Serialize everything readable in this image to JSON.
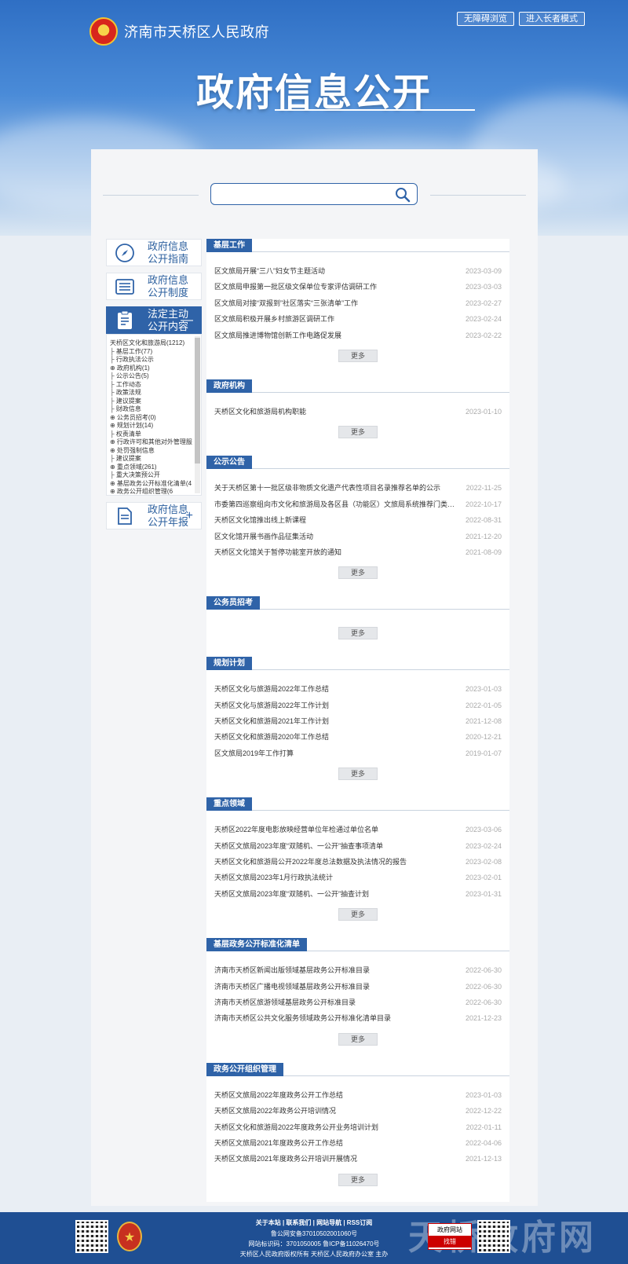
{
  "header": {
    "site_name": "济南市天桥区人民政府",
    "btn_accessible": "无障碍浏览",
    "btn_elder": "进入长者模式",
    "title": "政府信息公开"
  },
  "search": {
    "value": "",
    "placeholder": ""
  },
  "sidebar": {
    "cards": [
      {
        "label": "政府信息公开指南",
        "icon": "compass-icon"
      },
      {
        "label": "政府信息公开制度",
        "icon": "list-icon"
      },
      {
        "label": "法定主动公开内容",
        "icon": "clipboard-icon",
        "sign": "—"
      },
      {
        "label": "政府信息公开年报",
        "icon": "document-icon",
        "sign": "+"
      }
    ],
    "tree": [
      "天桥区文化和旅游局(1212)",
      "├ 基层工作(77)",
      "├ 行政执法公示",
      "⊕ 政府机构(1)",
      "├ 公示公告(5)",
      "├ 工作动态",
      "├ 政策法规",
      "├ 建议提案",
      "├ 财政信息",
      "⊕ 公务员招考(0)",
      "⊕ 规划计划(14)",
      "├ 权责清单",
      "⊕ 行政许可和其他对外管理服",
      "⊕ 处罚强制信息",
      "├ 建议提案",
      "⊕ 重点领域(261)",
      "├ 重大决策预公开",
      "⊕ 基层政务公开标准化清单(4",
      "⊕ 政务公开组织管理(6"
    ]
  },
  "sections": [
    {
      "title": "基层工作",
      "more": "更多",
      "items": [
        {
          "t": "区文旅局开展“三八”妇女节主题活动",
          "d": "2023-03-09"
        },
        {
          "t": "区文旅局申报第一批区级文保单位专家评估调研工作",
          "d": "2023-03-03"
        },
        {
          "t": "区文旅局对接“双报到”社区落实“三张清单”工作",
          "d": "2023-02-27"
        },
        {
          "t": "区文旅局积极开展乡村旅游区调研工作",
          "d": "2023-02-24"
        },
        {
          "t": "区文旅局推进博物馆创新工作电路促发展",
          "d": "2023-02-22"
        }
      ]
    },
    {
      "title": "政府机构",
      "more": "更多",
      "items": [
        {
          "t": "天桥区文化和旅游局机构职能",
          "d": "2023-01-10"
        }
      ]
    },
    {
      "title": "公示公告",
      "more": "更多",
      "items": [
        {
          "t": "关于天桥区第十一批区级非物质文化遗产代表性项目名录推荐名单的公示",
          "d": "2022-11-25"
        },
        {
          "t": "市委第四巡察组向市文化和旅游局及各区县（功能区）文旅局系统推荐门类组织...",
          "d": "2022-10-17"
        },
        {
          "t": "天桥区文化馆推出线上新课程",
          "d": "2022-08-31"
        },
        {
          "t": "区文化馆开展书画作品征集活动",
          "d": "2021-12-20"
        },
        {
          "t": "天桥区文化馆关于暂停功能室开放的通知",
          "d": "2021-08-09"
        }
      ]
    },
    {
      "title": "公务员招考",
      "more": "更多",
      "items": []
    },
    {
      "title": "规划计划",
      "more": "更多",
      "items": [
        {
          "t": "天桥区文化与旅游局2022年工作总结",
          "d": "2023-01-03"
        },
        {
          "t": "天桥区文化与旅游局2022年工作计划",
          "d": "2022-01-05"
        },
        {
          "t": "天桥区文化和旅游局2021年工作计划",
          "d": "2021-12-08"
        },
        {
          "t": "天桥区文化和旅游局2020年工作总结",
          "d": "2020-12-21"
        },
        {
          "t": "区文旅局2019年工作打算",
          "d": "2019-01-07"
        }
      ]
    },
    {
      "title": "重点领域",
      "more": "更多",
      "items": [
        {
          "t": "天桥区2022年度电影放映经营单位年检通过单位名单",
          "d": "2023-03-06"
        },
        {
          "t": "天桥区文旅局2023年度“双随机、一公开”抽查事项清单",
          "d": "2023-02-24"
        },
        {
          "t": "天桥区文化和旅游局公开2022年度总法数据及执法情况的报告",
          "d": "2023-02-08"
        },
        {
          "t": "天桥区文旅局2023年1月行政执法统计",
          "d": "2023-02-01"
        },
        {
          "t": "天桥区文旅局2023年度“双随机、一公开”抽查计划",
          "d": "2023-01-31"
        }
      ]
    },
    {
      "title": "基层政务公开标准化清单",
      "more": "更多",
      "items": [
        {
          "t": "济南市天桥区新闻出版领域基层政务公开标准目录",
          "d": "2022-06-30"
        },
        {
          "t": "济南市天桥区广播电视领域基层政务公开标准目录",
          "d": "2022-06-30"
        },
        {
          "t": "济南市天桥区旅游领域基层政务公开标准目录",
          "d": "2022-06-30"
        },
        {
          "t": "济南市天桥区公共文化服务领域政务公开标准化清单目录",
          "d": "2021-12-23"
        }
      ]
    },
    {
      "title": "政务公开组织管理",
      "more": "更多",
      "items": [
        {
          "t": "天桥区文旅局2022年度政务公开工作总结",
          "d": "2023-01-03"
        },
        {
          "t": "天桥区文旅局2022年政务公开培训情况",
          "d": "2022-12-22"
        },
        {
          "t": "天桥区文化和旅游局2022年度政务公开业务培训计划",
          "d": "2022-01-11"
        },
        {
          "t": "天桥区文旅局2021年度政务公开工作总结",
          "d": "2022-04-06"
        },
        {
          "t": "天桥区文旅局2021年度政务公开培训开展情况",
          "d": "2021-12-13"
        }
      ]
    }
  ],
  "footer": {
    "links": "关于本站 | 联系我们 | 网站导航 | RSS订阅",
    "police": "鲁公网安备37010502001060号",
    "icp": "网站标识码：3701050005  鲁ICP备11026470号",
    "host": "天桥区人民政府版权所有  天桥区人民政府办公室 主办",
    "brand": "天桥政府网",
    "error_top": "政府网站",
    "error_bottom": "找错"
  },
  "colors": {
    "primary": "#2f63a8",
    "footer": "#1f4f93",
    "date": "#aaaaaa"
  }
}
